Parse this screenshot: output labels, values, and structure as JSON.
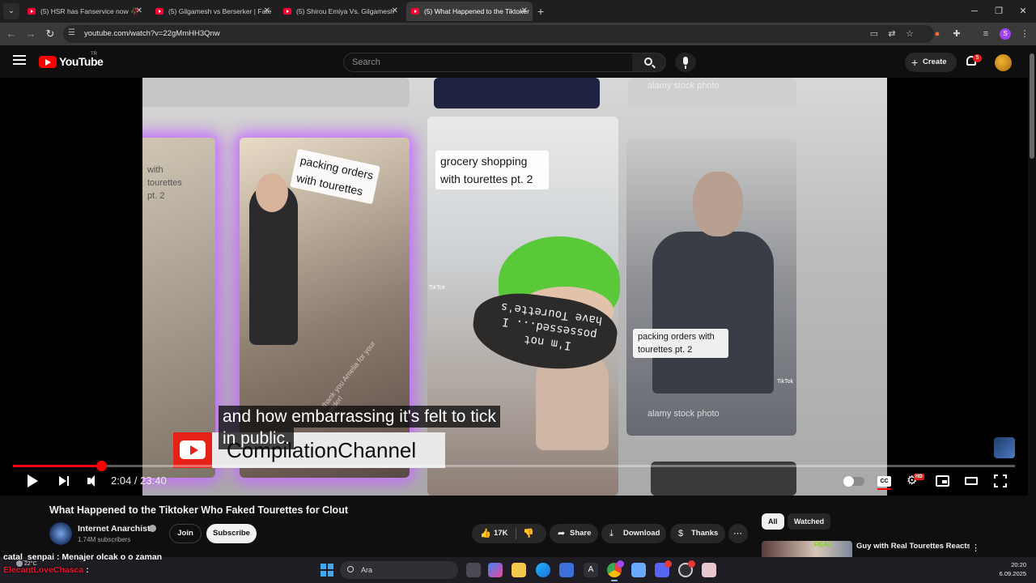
{
  "browser": {
    "tabs": [
      {
        "title": "(5) HSR has Fanservice now 🥀",
        "active": false
      },
      {
        "title": "(5) Gilgamesh vs Berserker | Fate",
        "active": false
      },
      {
        "title": "(5) Shirou Emiya Vs. Gilgamesh",
        "active": false
      },
      {
        "title": "(5) What Happened to the Tiktoker",
        "active": true
      }
    ],
    "url": "youtube.com/watch?v=22gMmHH3Qnw",
    "profile_initial": "S"
  },
  "header": {
    "logo_text": "YouTube",
    "region": "TR",
    "search_placeholder": "Search",
    "create_label": "Create",
    "notification_count": "5"
  },
  "player": {
    "frame_captions": {
      "left": "packing orders with tourettes",
      "left_partial": "with tourettes pt. 2",
      "center": "grocery shopping with tourettes pt. 2",
      "right": "packing orders with tourettes pt. 2",
      "stock_top": "alamy stock photo",
      "stock_bottom": "alamy stock photo",
      "mask_text": "I'm not possessed... I have Tourette's",
      "box_text": "thank you Amelia for your order!",
      "tiktok": "TikTok",
      "tiktok_small": "TikTok"
    },
    "subtitle_line1": "and how embarrassing it's felt to tick",
    "subtitle_line2": "in public.",
    "brand_name": "CompilationChannel",
    "current_time": "2:04",
    "duration": "23:40",
    "time_display": "2:04 / 23:40",
    "progress_fraction": 0.0883,
    "cc_label": "CC",
    "hd_label": "HD"
  },
  "video": {
    "title": "What Happened to the Tiktoker Who Faked Tourettes for Clout",
    "channel_name": "Internet Anarchist",
    "subscribers": "1.74M subscribers",
    "join_label": "Join",
    "subscribe_label": "Subscribe",
    "likes": "17K",
    "share_label": "Share",
    "download_label": "Download",
    "thanks_label": "Thanks"
  },
  "sidebar": {
    "chips": [
      "All",
      "Watched"
    ],
    "recommendation": {
      "title": "Guy with Real Tourettes Reacts to Tiktoker Faking Tourettes",
      "thumb_label": "REAL"
    }
  },
  "chat": {
    "line1": "catal_senpai : Menajer olcak o o zaman",
    "line2_user": "ElecantLoveChasca",
    "line2_sep": " :"
  },
  "taskbar": {
    "temperature": "22°C",
    "search_label": "Ara",
    "time": "20:20",
    "date": "6.09.2025"
  },
  "colors": {
    "youtube_red": "#ff0000",
    "background": "#0f0f0f",
    "chip_active": "#f1f1f1"
  }
}
